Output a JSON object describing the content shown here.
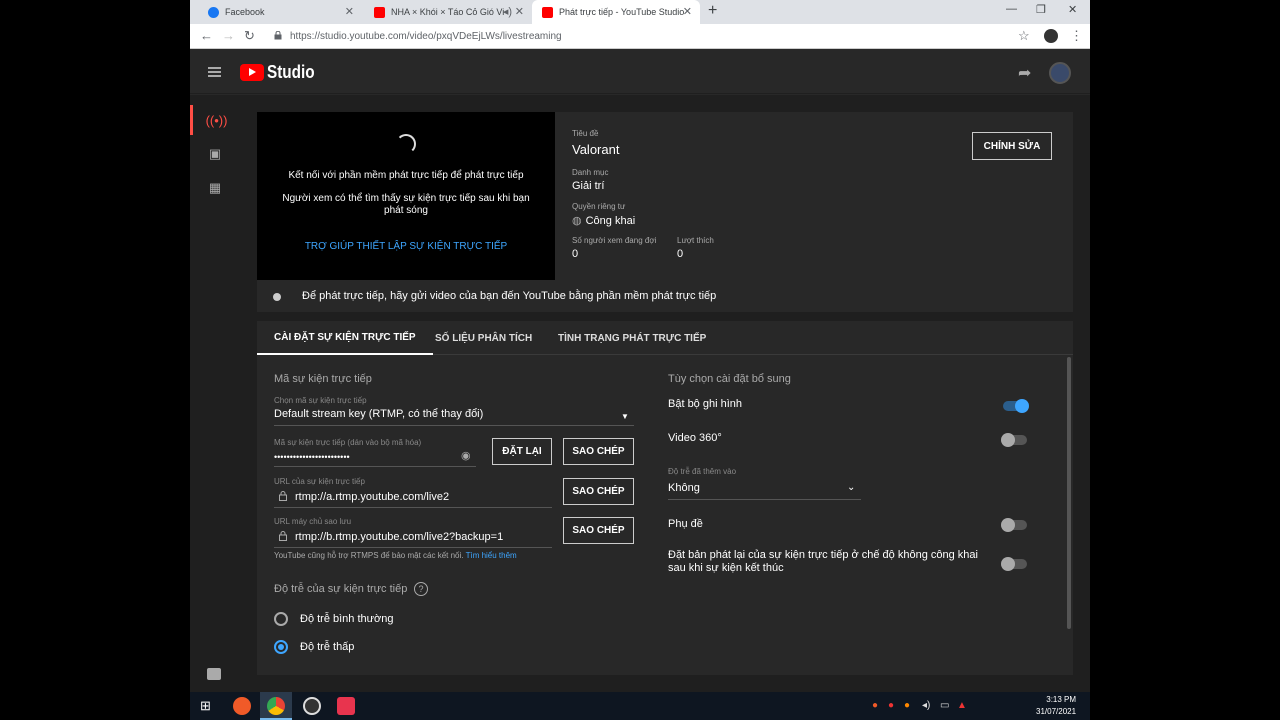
{
  "browser": {
    "tabs": [
      {
        "title": "Facebook",
        "favicon_color": "#1877f2"
      },
      {
        "title": "NHA × Khói × Táo Cỏ Gió Vi",
        "favicon_color": "#ff0000"
      },
      {
        "title": "Phát trực tiếp - YouTube Studio",
        "favicon_color": "#ff0000"
      }
    ],
    "url": "https://studio.youtube.com/video/pxqVDeEjLWs/livestreaming"
  },
  "header": {
    "app_title": "Studio"
  },
  "preview": {
    "line1": "Kết nối với phần mềm phát trực tiếp để phát trực tiếp",
    "line2": "Người xem có thể tìm thấy sự kiện trực tiếp sau khi bạn phát sóng",
    "help_link": "TRỢ GIÚP THIẾT LẬP SỰ KIỆN TRỰC TIẾP"
  },
  "stream_info": {
    "title_label": "Tiêu đề",
    "title": "Valorant",
    "category_label": "Danh mục",
    "category": "Giải trí",
    "privacy_label": "Quyền riêng tư",
    "privacy": "Công khai",
    "viewers_label": "Số người xem đang đợi",
    "viewers": "0",
    "likes_label": "Lượt thích",
    "likes": "0",
    "edit_button": "CHỈNH SỬA"
  },
  "status": {
    "text": "Để phát trực tiếp, hãy gửi video của bạn đến YouTube bằng phần mềm phát trực tiếp"
  },
  "tabs": [
    {
      "label": "CÀI ĐẶT SỰ KIỆN TRỰC TIẾP",
      "active": true
    },
    {
      "label": "SỐ LIỆU PHÂN TÍCH",
      "active": false
    },
    {
      "label": "TÌNH TRẠNG PHÁT TRỰC TIẾP",
      "active": false
    }
  ],
  "stream_key": {
    "section_title": "Mã sự kiện trực tiếp",
    "select_label": "Chọn mã sự kiện trực tiếp",
    "select_value": "Default stream key (RTMP, có thể thay đổi)",
    "key_label": "Mã sự kiện trực tiếp (dán vào bộ mã hóa)",
    "key_value": "••••••••••••••••••••••••",
    "reset_button": "ĐẶT LẠI",
    "copy_button": "SAO CHÉP",
    "url_label": "URL của sự kiện trực tiếp",
    "url_value": "rtmp://a.rtmp.youtube.com/live2",
    "backup_label": "URL máy chủ sao lưu",
    "backup_value": "rtmp://b.rtmp.youtube.com/live2?backup=1",
    "rtmps_note": "YouTube cũng hỗ trợ RTMPS để bảo mật các kết nối.",
    "rtmps_link": "Tìm hiểu thêm"
  },
  "latency": {
    "title": "Độ trễ của sự kiện trực tiếp",
    "options": [
      {
        "label": "Độ trễ bình thường",
        "selected": false
      },
      {
        "label": "Độ trễ thấp",
        "selected": true
      }
    ]
  },
  "extra": {
    "title": "Tùy chọn cài đặt bổ sung",
    "dvr": "Bật bộ ghi hình",
    "dvr_on": true,
    "video360": "Video 360°",
    "video360_on": false,
    "delay_label": "Độ trễ đã thêm vào",
    "delay_value": "Không",
    "captions": "Phụ đề",
    "captions_on": false,
    "unlisted": "Đặt bản phát lại của sự kiện trực tiếp ở chế độ không công khai sau khi sự kiện kết thúc",
    "unlisted_on": false
  },
  "taskbar": {
    "time": "3:13 PM",
    "date": "31/07/2021"
  }
}
